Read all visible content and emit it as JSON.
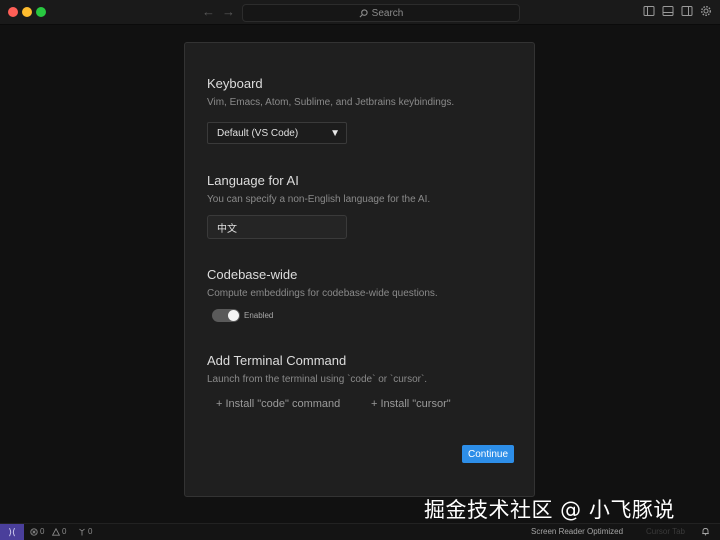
{
  "titlebar": {
    "back_arrow": "←",
    "forward_arrow": "→",
    "search_placeholder": "Search"
  },
  "keyboard": {
    "title": "Keyboard",
    "description": "Vim, Emacs, Atom, Sublime, and Jetbrains keybindings.",
    "selected": "Default (VS Code)",
    "caret": "▼"
  },
  "language": {
    "title": "Language for AI",
    "description": "You can specify a non-English language for the AI.",
    "value": "中文"
  },
  "codebase": {
    "title": "Codebase-wide",
    "description": "Compute embeddings for codebase-wide questions.",
    "toggle_label": "Enabled",
    "enabled": true
  },
  "terminal": {
    "title": "Add Terminal Command",
    "description": "Launch from the terminal using `code` or `cursor`.",
    "install_code_label": "+ Install \"code\" command",
    "install_cursor_label": "+ Install \"cursor\""
  },
  "continue_label": "Continue",
  "statusbar": {
    "remote_icon": "⟩⟨",
    "errors": "0",
    "warnings": "0",
    "ports": "0",
    "screen_reader": "Screen Reader Optimized",
    "cursor_tab": "Cursor Tab"
  },
  "watermark": "掘金技术社区 @ 小飞豚说",
  "colors": {
    "accent": "#2d8ee8",
    "remote": "#4a3f9b",
    "dialog_bg": "#1f1f1f"
  }
}
